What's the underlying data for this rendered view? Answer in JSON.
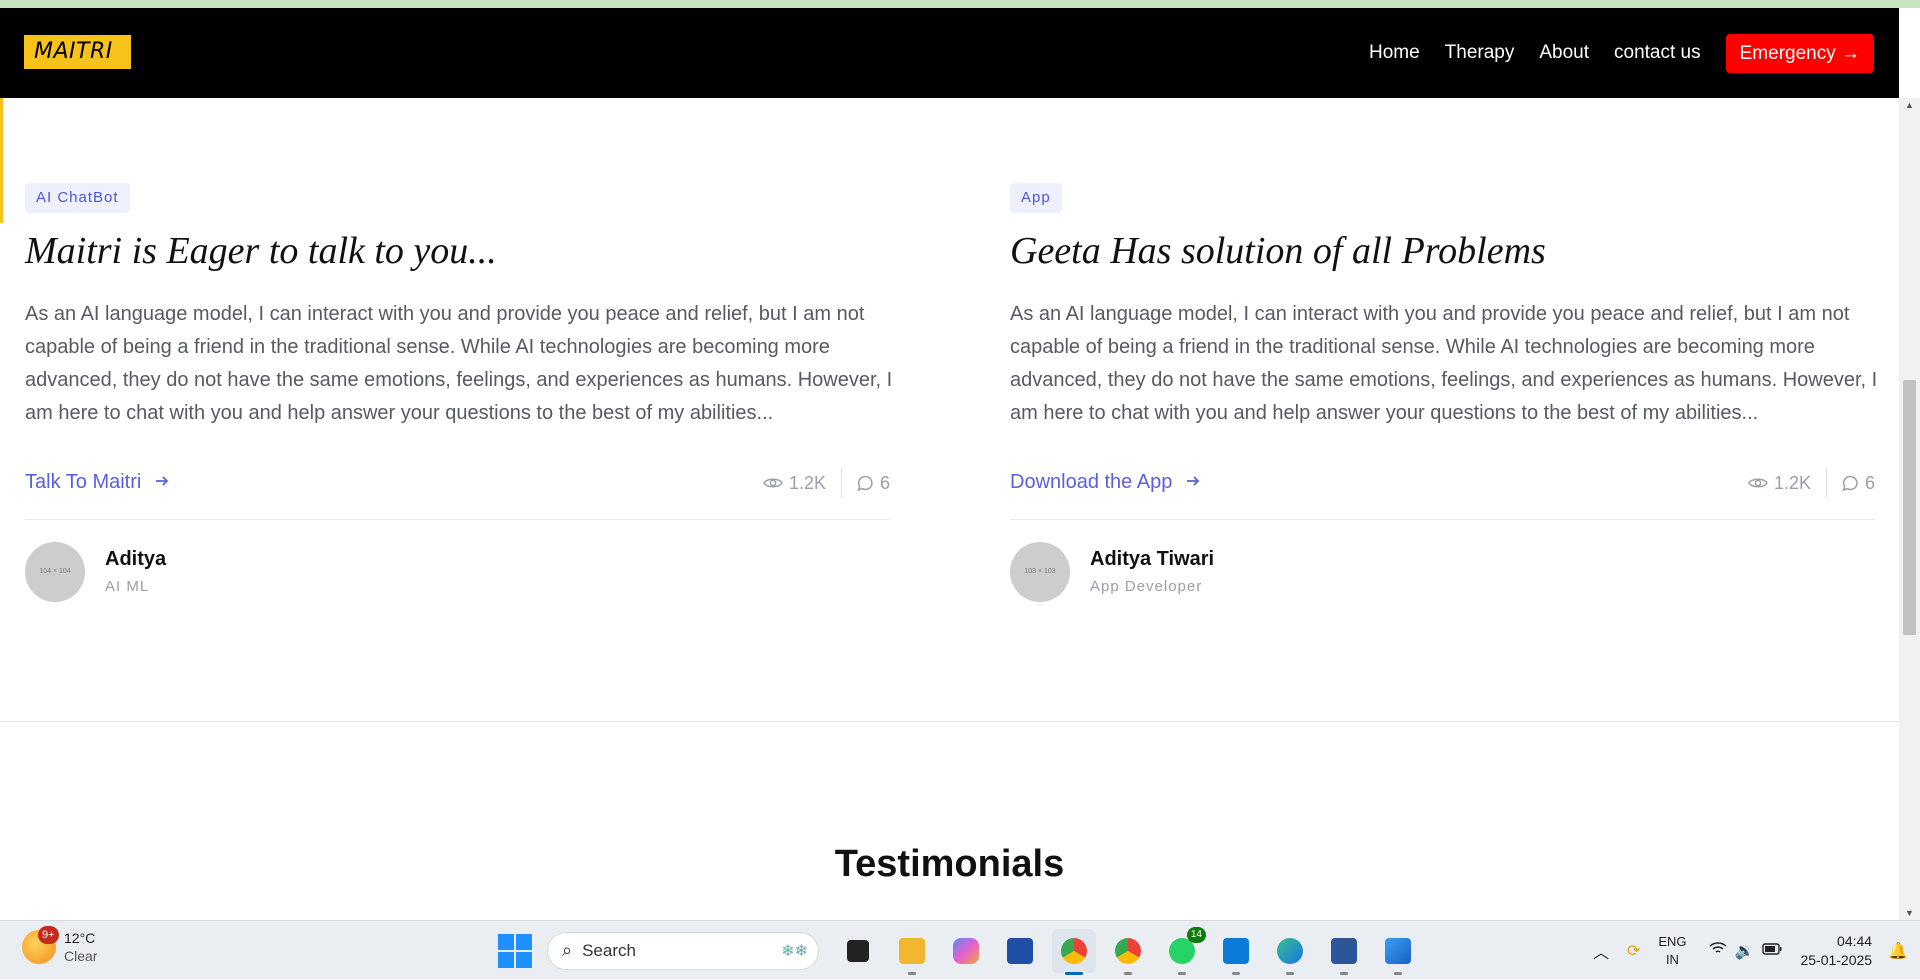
{
  "navbar": {
    "logo": "MAITRI",
    "links": [
      "Home",
      "Therapy",
      "About",
      "contact us"
    ],
    "emergency_label": "Emergency →"
  },
  "cards": [
    {
      "tag": "AI ChatBot",
      "title": "Maitri is Eager to talk to you...",
      "description": "As an AI language model, I can interact with you and provide you peace and relief, but I am not capable of being a friend in the traditional sense. While AI technologies are becoming more advanced, they do not have the same emotions, feelings, and experiences as humans. However, I am here to chat with you and help answer your questions to the best of my abilities...",
      "link_label": "Talk To Maitri",
      "views": "1.2K",
      "comments": "6",
      "avatar_text": "104 × 104",
      "author": "Aditya",
      "role": "AI ML"
    },
    {
      "tag": "App",
      "title": "Geeta Has solution of all Problems",
      "description": "As an AI language model, I can interact with you and provide you peace and relief, but I am not capable of being a friend in the traditional sense. While AI technologies are becoming more advanced, they do not have the same emotions, feelings, and experiences as humans. However, I am here to chat with you and help answer your questions to the best of my abilities...",
      "link_label": "Download the App",
      "views": "1.2K",
      "comments": "6",
      "avatar_text": "103 × 103",
      "author": "Aditya Tiwari",
      "role": "App Developer"
    }
  ],
  "testimonials_heading": "Testimonials",
  "taskbar": {
    "weather_temp": "12°C",
    "weather_desc": "Clear",
    "weather_badge": "9+",
    "search_placeholder": "Search",
    "whatsapp_badge": "14",
    "lang_line1": "ENG",
    "lang_line2": "IN",
    "time": "04:44",
    "date": "25-01-2025"
  },
  "colors": {
    "accent": "#5b5fde",
    "logo_bg": "#f7c21a",
    "emergency": "#ff0000"
  }
}
